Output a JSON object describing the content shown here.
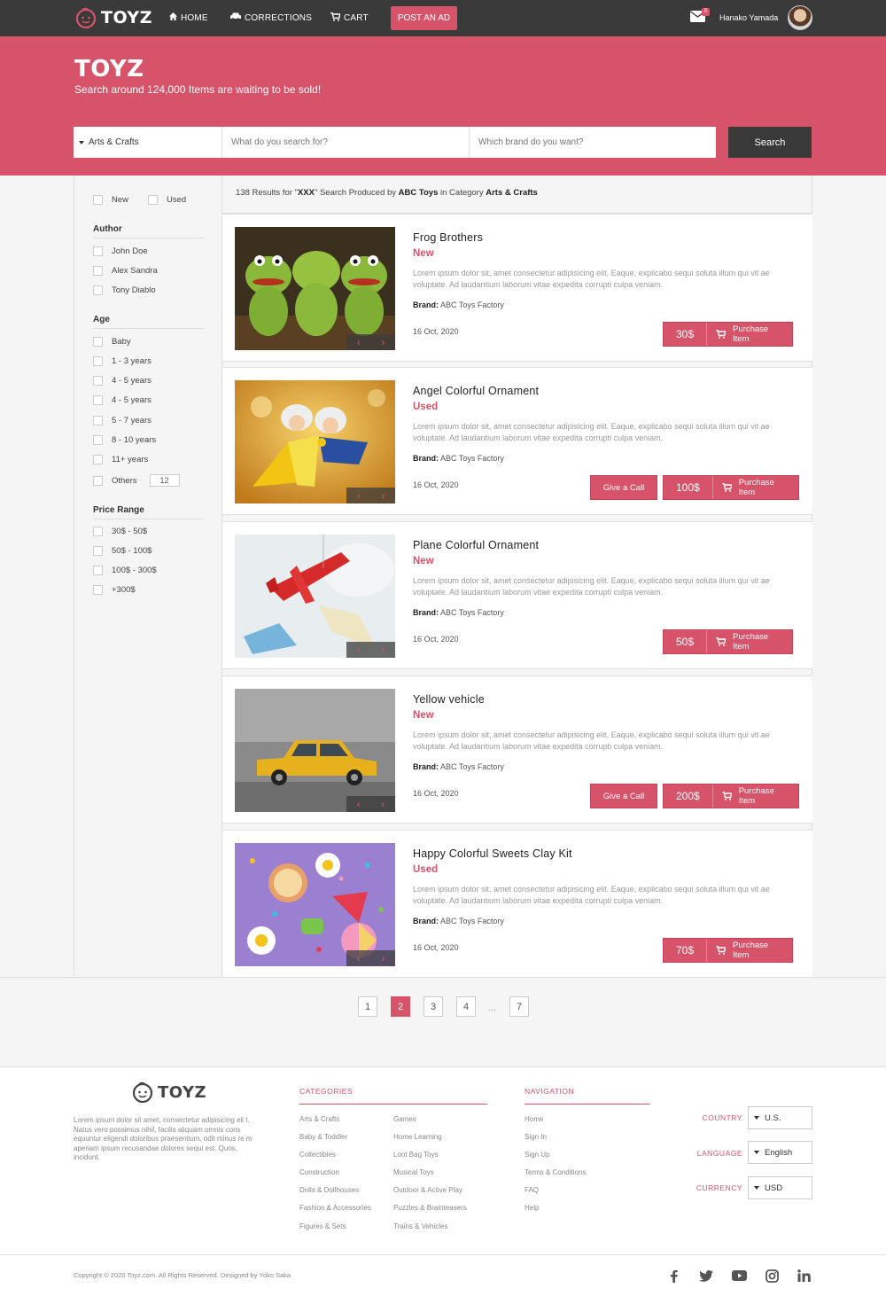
{
  "header": {
    "brand": "TOYZ",
    "nav": [
      {
        "label": "HOME",
        "icon": "home-icon"
      },
      {
        "label": "CORRECTIONS",
        "icon": "car-icon"
      },
      {
        "label": "CART",
        "icon": "cart-icon"
      }
    ],
    "post_ad": "POST AN AD",
    "mail_count": "5",
    "user_name": "Hanako Yamada"
  },
  "hero": {
    "title": "TOYZ",
    "subtitle": "Search around 124,000 Items are waiting to be sold!",
    "category_value": "Arts & Crafts",
    "search_placeholder": "What do you search for?",
    "brand_placeholder": "Which brand do you want?",
    "search_button": "Search"
  },
  "filters": {
    "condition": [
      "New",
      "Used"
    ],
    "author": {
      "title": "Author",
      "items": [
        "John Doe",
        "Alex Sandra",
        "Tony Diablo"
      ]
    },
    "age": {
      "title": "Age",
      "items": [
        "Baby",
        "1 - 3 years",
        "4 - 5 years",
        "4 - 5 years",
        "5 - 7 years",
        "8 - 10 years",
        "11+ years",
        "Others"
      ],
      "others_value": "12"
    },
    "price": {
      "title": "Price Range",
      "items": [
        "30$ - 50$",
        "50$ - 100$",
        "100$ - 300$",
        "+300$"
      ]
    }
  },
  "results": {
    "count": "138",
    "text1": "Results for \"",
    "query": "XXX",
    "text2": "\" Search Produced by",
    "brand": "ABC Toys",
    "text3": "in Category",
    "category": "Arts & Crafts"
  },
  "products": [
    {
      "title": "Frog Brothers",
      "condition": "New",
      "description": "Lorem ipsum dolor sit, amet consectetur adipisicing elit. Eaque, explicabo sequi soluta illum qui vit ae voluptate. Ad laudantium laborum vitae expedita corrupti culpa veniam.",
      "brand_label": "Brand:",
      "brand": "ABC Toys Factory",
      "date": "16 Oct, 2020",
      "price": "30$",
      "buy_label": "Purchase Item",
      "call_label": ""
    },
    {
      "title": "Angel Colorful Ornament",
      "condition": "Used",
      "description": "Lorem ipsum dolor sit, amet consectetur adipisicing elit. Eaque, explicabo sequi soluta illum qui vit ae voluptate. Ad laudantium laborum vitae expedita corrupti culpa veniam.",
      "brand_label": "Brand:",
      "brand": "ABC Toys Factory",
      "date": "16 Oct, 2020",
      "price": "100$",
      "buy_label": "Purchase Item",
      "call_label": "Give a Call"
    },
    {
      "title": "Plane Colorful Ornament",
      "condition": "New",
      "description": "Lorem ipsum dolor sit, amet consectetur adipisicing elit. Eaque, explicabo sequi soluta illum qui vit ae voluptate. Ad laudantium laborum vitae expedita corrupti culpa veniam.",
      "brand_label": "Brand:",
      "brand": "ABC Toys Factory",
      "date": "16 Oct, 2020",
      "price": "50$",
      "buy_label": "Purchase Item",
      "call_label": ""
    },
    {
      "title": "Yellow vehicle",
      "condition": "New",
      "description": "Lorem ipsum dolor sit, amet consectetur adipisicing elit. Eaque, explicabo sequi soluta illum qui vit ae voluptate. Ad laudantium laborum vitae expedita corrupti culpa veniam.",
      "brand_label": "Brand:",
      "brand": "ABC Toys Factory",
      "date": "16 Oct, 2020",
      "price": "200$",
      "buy_label": "Purchase Item",
      "call_label": "Give a Call"
    },
    {
      "title": "Happy Colorful Sweets Clay Kit",
      "condition": "Used",
      "description": "Lorem ipsum dolor sit, amet consectetur adipisicing elit. Eaque, explicabo sequi soluta illum qui vit ae voluptate. Ad laudantium laborum vitae expedita corrupti culpa veniam.",
      "brand_label": "Brand:",
      "brand": "ABC Toys Factory",
      "date": "16 Oct, 2020",
      "price": "70$",
      "buy_label": "Purchase Item",
      "call_label": ""
    }
  ],
  "pagination": {
    "pages": [
      "1",
      "2",
      "3",
      "4",
      "7"
    ],
    "active": "2",
    "ellipsis": "..."
  },
  "footer": {
    "brand": "TOYZ",
    "about": "Lorem ipsum dolor sit amet, consectetur adipisicing eli t. Natus vero possimus nihil, facilis aliquam omnis cons equuntur eligendi doloribus praesentium, odit minus re m aperiam ipsum recusandae dolores sequi est. Quos, incidunt.",
    "categories_title": "CATEGORIES",
    "categories_col1": [
      "Arts & Crafts",
      "Baby & Toddler",
      "Collectibles",
      "Construction",
      "Dolls & Dollhouses",
      "Fashion & Accessories",
      "Figures & Sets"
    ],
    "categories_col2": [
      "Games",
      "Home Learning",
      "Loot Bag Toys",
      "Musical Toys",
      "Outdoor & Active Play",
      "Puzzles & Brainteasers",
      "Trains & Vehicles"
    ],
    "navigation_title": "NAVIGATION",
    "navigation": [
      "Home",
      "Sign In",
      "Sign Up",
      "Terms & Conditions",
      "FAQ",
      "Help"
    ],
    "country_label": "COUNTRY",
    "country_value": "U.S.",
    "language_label": "LANGUAGE",
    "language_value": "English",
    "currency_label": "CURRENCY",
    "currency_value": "USD",
    "copyright": "Copyright © 2020 Toyz.com. All Rights Reserved. Designed by Yoko Saka.",
    "social": [
      "facebook-icon",
      "twitter-icon",
      "youtube-icon",
      "instagram-icon",
      "linkedin-icon"
    ]
  },
  "colors": {
    "accent": "#d6536a",
    "dark": "#3a3a3a"
  }
}
